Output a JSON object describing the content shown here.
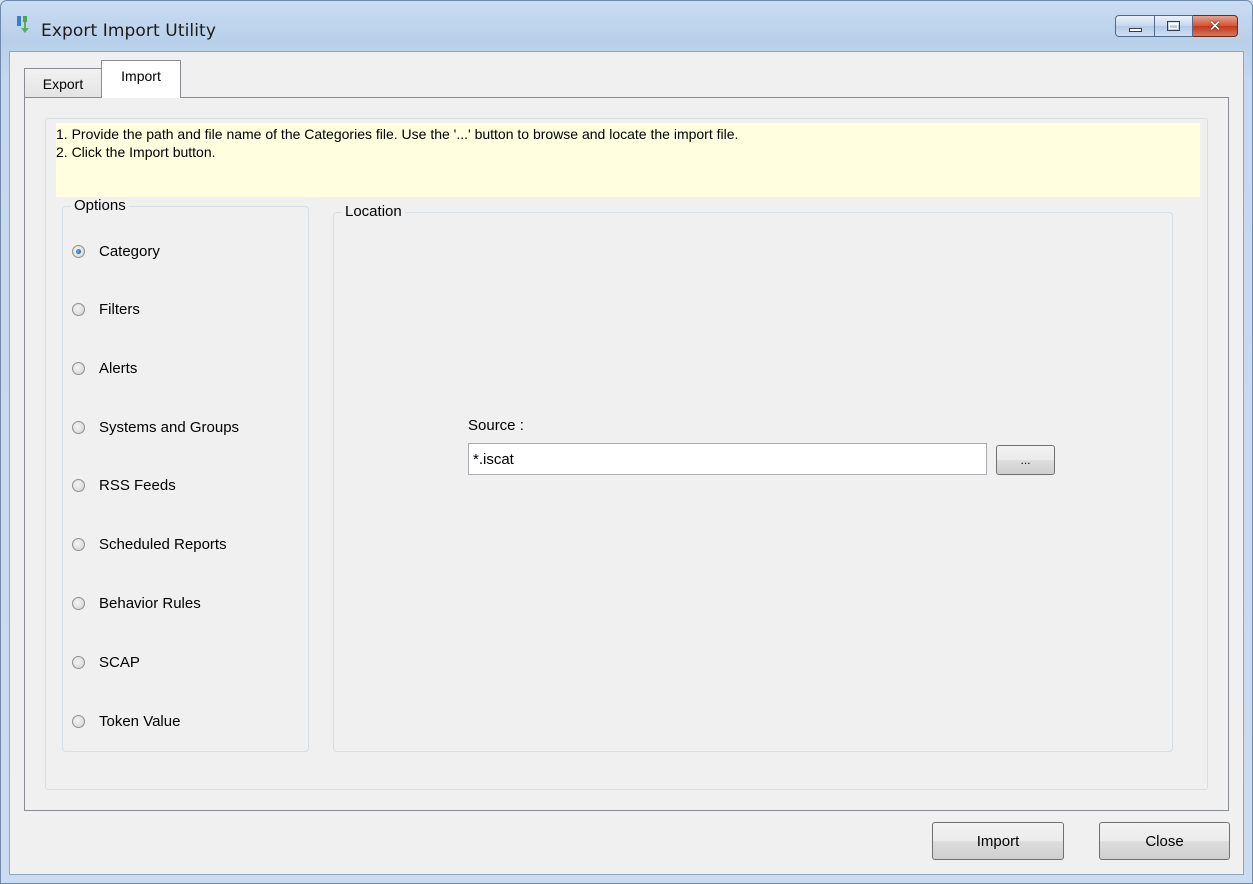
{
  "window": {
    "title": "Export Import Utility",
    "caption_buttons": [
      "minimize",
      "maximize",
      "close"
    ]
  },
  "tabs": [
    {
      "label": "Export",
      "selected": false
    },
    {
      "label": "Import",
      "selected": true
    }
  ],
  "instructions": {
    "line1": "1. Provide the path and file name of the Categories file. Use the '...' button to browse and locate the import file.",
    "line2": "2. Click the Import button."
  },
  "options": {
    "legend": "Options",
    "items": [
      {
        "label": "Category",
        "checked": true
      },
      {
        "label": "Filters",
        "checked": false
      },
      {
        "label": "Alerts",
        "checked": false
      },
      {
        "label": "Systems and Groups",
        "checked": false
      },
      {
        "label": "RSS Feeds",
        "checked": false
      },
      {
        "label": "Scheduled Reports",
        "checked": false
      },
      {
        "label": "Behavior Rules",
        "checked": false
      },
      {
        "label": "SCAP",
        "checked": false
      },
      {
        "label": "Token Value",
        "checked": false
      }
    ]
  },
  "location": {
    "legend": "Location",
    "source_label": "Source :",
    "source_value": "*.iscat",
    "browse_label": "..."
  },
  "footer": {
    "import_label": "Import",
    "close_label": "Close"
  },
  "colors": {
    "instructions_bg": "#ffffe0",
    "client_bg": "#f0f0f0",
    "close_button": "#c0391e"
  }
}
